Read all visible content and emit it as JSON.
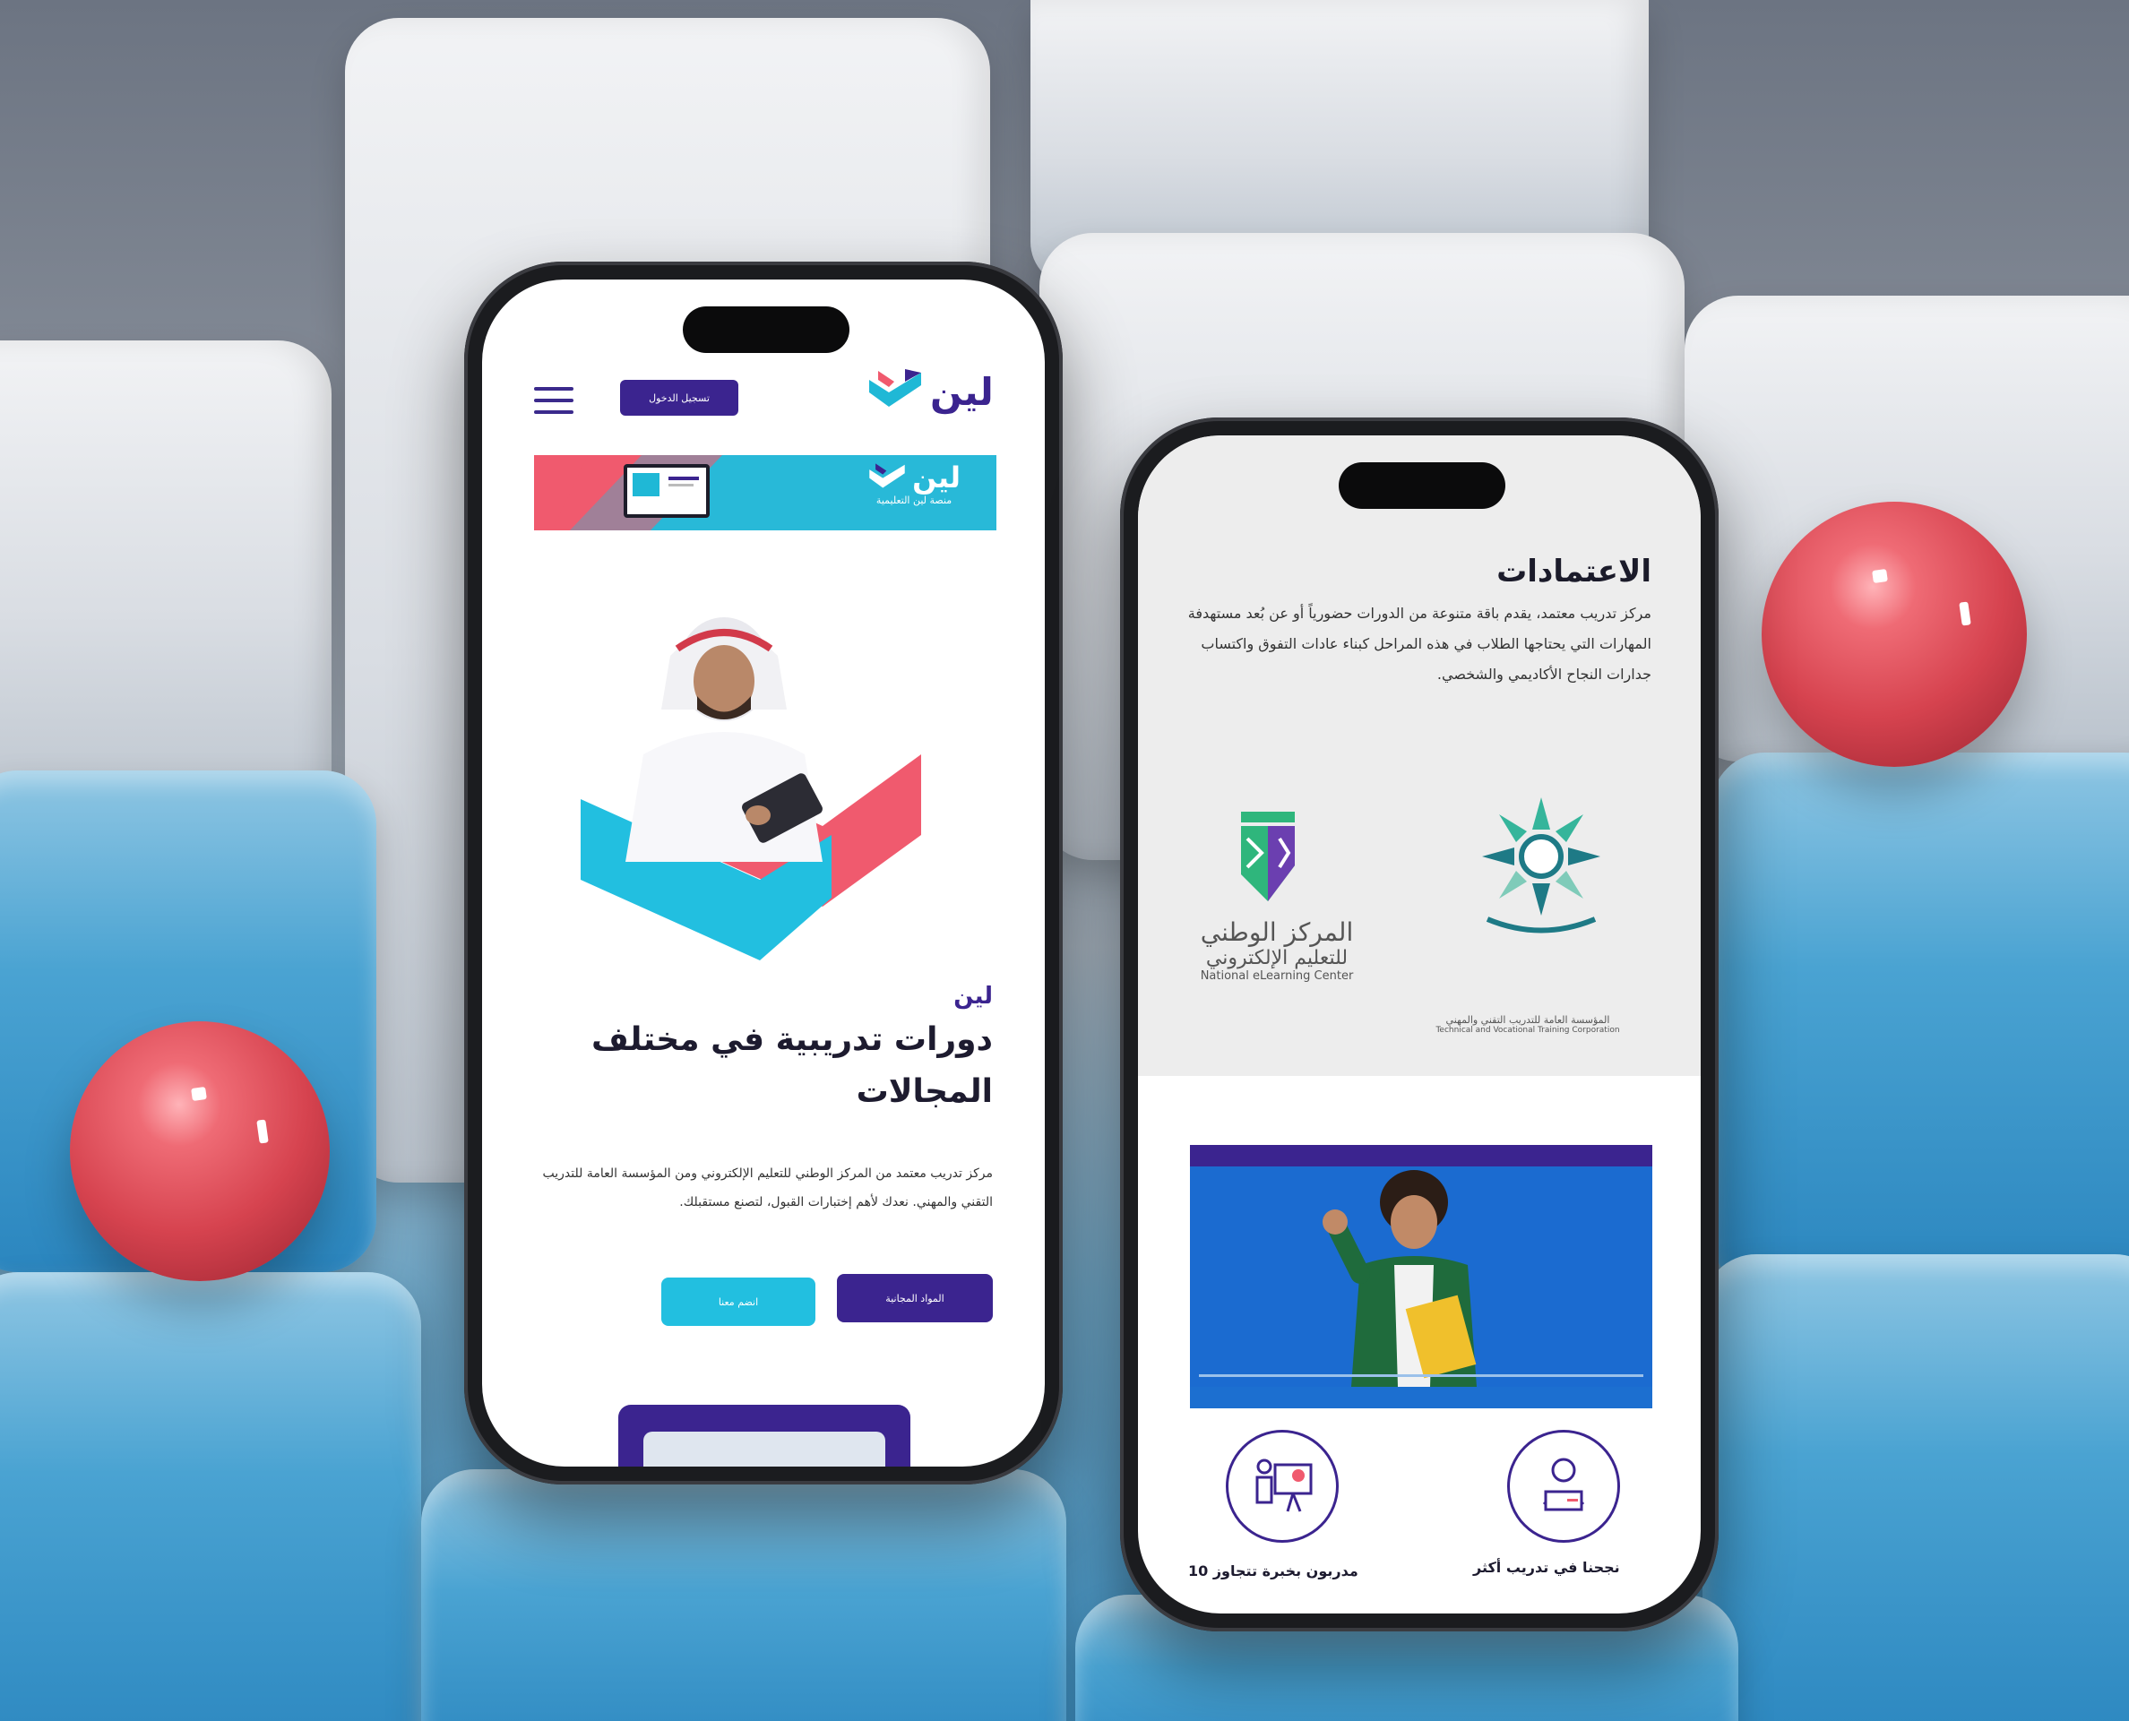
{
  "phone_left": {
    "header": {
      "logo_text": "لين",
      "login_label": "تسجيل الدخول",
      "menu_icon": "hamburger-icon"
    },
    "banner": {
      "logo_text": "لين",
      "subtitle": "منصة لين التعليمية"
    },
    "hero": {
      "brand": "لين",
      "headline": "دورات تدريبية في مختلف المجالات",
      "paragraph": "مركز تدريب معتمد من المركز الوطني للتعليم الإلكتروني ومن المؤسسة العامة للتدريب التقني والمهني. نعدك لأهم إختبارات القبول، لتصنع مستقبلك."
    },
    "buttons": {
      "primary": "المواد المجانية",
      "secondary": "انضم معنا"
    }
  },
  "phone_right": {
    "section_title": "الاعتمادات",
    "paragraph": "مركز تدريب معتمد، يقدم باقة متنوعة من الدورات حضورياً أو عن بُعد مستهدفة المهارات التي يحتاجها الطلاب في هذه المراحل كبناء عادات التفوق واكتساب جدارات النجاح الأكاديمي والشخصي.",
    "logos": [
      {
        "ar1": "المركز الوطني",
        "ar2": "للتعليم الإلكتروني",
        "en": "National eLearning Center"
      },
      {
        "ar": "المؤسسة العامة للتدريب التقني والمهني",
        "en": "Technical and Vocational Training Corporation"
      }
    ],
    "features": [
      {
        "label": "مدربون بخبرة تتجاوز 10",
        "icon": "presenter-icon"
      },
      {
        "label": "نجحنا في تدريب أكثر",
        "icon": "student-laptop-icon"
      }
    ]
  },
  "colors": {
    "brand_purple": "#3b248f",
    "brand_cyan": "#1fb8d6",
    "brand_pink": "#f05a6e"
  }
}
